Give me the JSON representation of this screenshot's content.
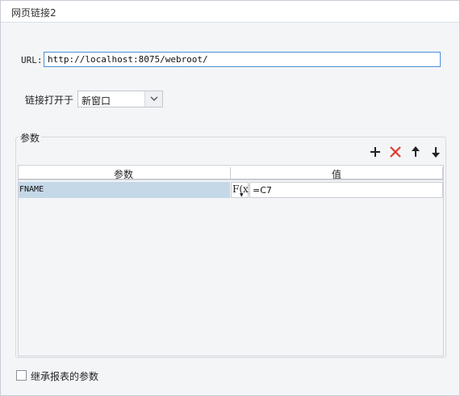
{
  "dialog": {
    "title": "网页链接2"
  },
  "url": {
    "label": "URL:",
    "value": "http://localhost:8075/webroot/"
  },
  "open_in": {
    "label": "链接打开于",
    "selected": "新窗口"
  },
  "params": {
    "group_title": "参数",
    "toolbar": {
      "add": "plus-icon",
      "delete": "delete-x-icon",
      "up": "arrow-up-icon",
      "down": "arrow-down-icon"
    },
    "columns": [
      "参数",
      "值"
    ],
    "rows": [
      {
        "name": "FNAME",
        "formula_label": "F(x)",
        "value": "=C7"
      }
    ]
  },
  "inherit_params": {
    "label": "继承报表的参数",
    "checked": false
  },
  "colors": {
    "accent": "#4a90d9",
    "delete": "#e03b2f",
    "row_selected": "#c5d8e8"
  }
}
